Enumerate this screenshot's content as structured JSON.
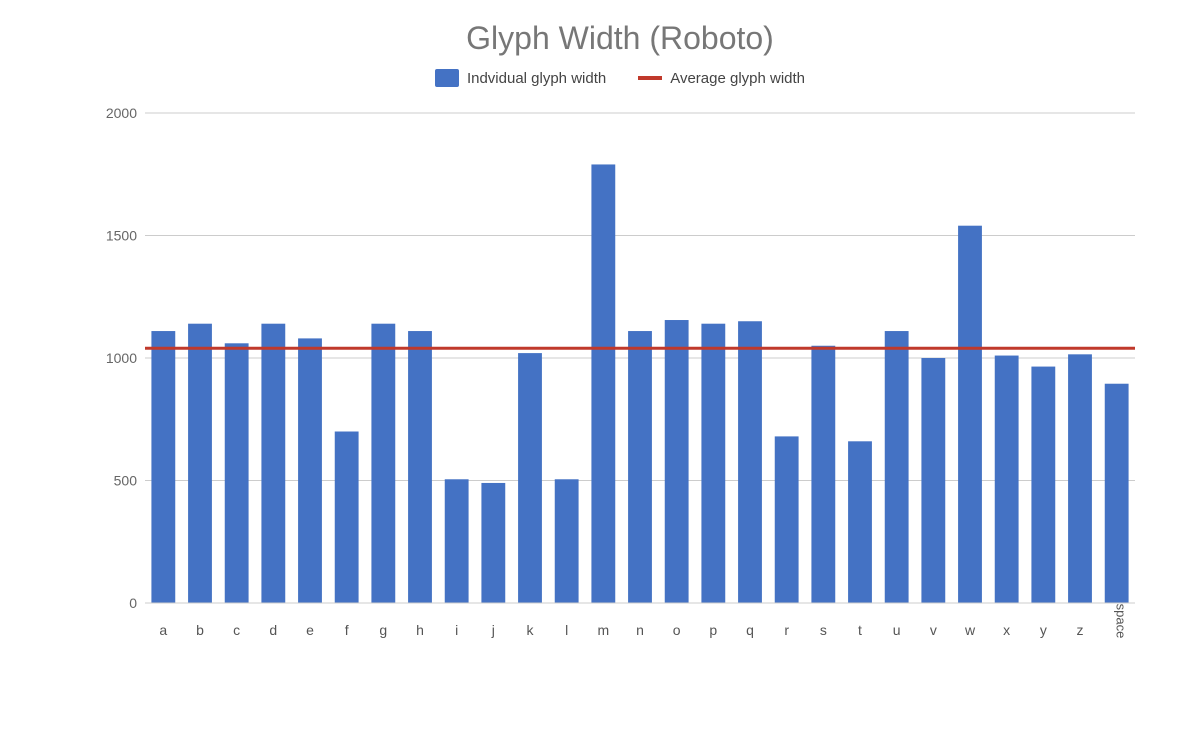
{
  "title": "Glyph Width (Roboto)",
  "legend": {
    "bar_label": "Indvidual glyph width",
    "line_label": "Average glyph width"
  },
  "chart": {
    "y_max": 2000,
    "y_ticks": [
      0,
      500,
      1000,
      1500,
      2000
    ],
    "average_value": 1040,
    "bar_color": "#4472c4",
    "line_color": "#c0392b",
    "bars": [
      {
        "label": "a",
        "value": 1110
      },
      {
        "label": "b",
        "value": 1140
      },
      {
        "label": "c",
        "value": 1060
      },
      {
        "label": "d",
        "value": 1140
      },
      {
        "label": "e",
        "value": 1080
      },
      {
        "label": "f",
        "value": 700
      },
      {
        "label": "g",
        "value": 1140
      },
      {
        "label": "h",
        "value": 1110
      },
      {
        "label": "i",
        "value": 505
      },
      {
        "label": "j",
        "value": 490
      },
      {
        "label": "k",
        "value": 1020
      },
      {
        "label": "l",
        "value": 505
      },
      {
        "label": "m",
        "value": 1790
      },
      {
        "label": "n",
        "value": 1110
      },
      {
        "label": "o",
        "value": 1155
      },
      {
        "label": "p",
        "value": 1140
      },
      {
        "label": "q",
        "value": 1150
      },
      {
        "label": "r",
        "value": 680
      },
      {
        "label": "s",
        "value": 1050
      },
      {
        "label": "t",
        "value": 660
      },
      {
        "label": "u",
        "value": 1110
      },
      {
        "label": "v",
        "value": 1000
      },
      {
        "label": "w",
        "value": 1540
      },
      {
        "label": "x",
        "value": 1010
      },
      {
        "label": "y",
        "value": 965
      },
      {
        "label": "z",
        "value": 1015
      },
      {
        "label": "space",
        "value": 895
      }
    ]
  }
}
